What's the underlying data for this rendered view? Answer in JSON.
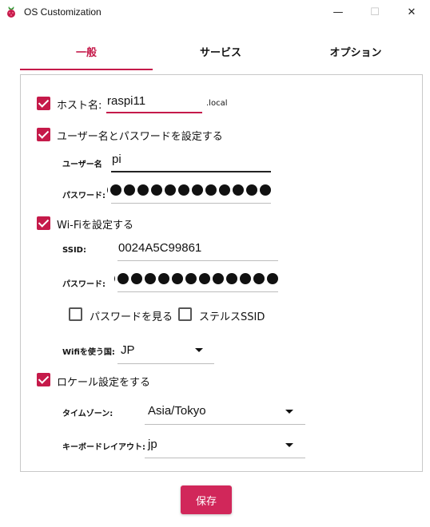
{
  "window": {
    "title": "OS Customization",
    "minimize_glyph": "—",
    "maximize_glyph": "☐",
    "close_glyph": "✕"
  },
  "tabs": [
    {
      "label": "一般",
      "active": true
    },
    {
      "label": "サービス",
      "active": false
    },
    {
      "label": "オプション",
      "active": false
    }
  ],
  "hostname": {
    "checked": true,
    "label": "ホスト名:",
    "value": "raspi11",
    "suffix": ".local"
  },
  "user": {
    "checked": true,
    "label": "ユーザー名とパスワードを設定する",
    "username_label": "ユーザー名",
    "username_value": "pi",
    "password_label": "パスワード:",
    "password_dot_count": 14
  },
  "wifi": {
    "checked": true,
    "label": "Wi-Fiを設定する",
    "ssid_label": "SSID:",
    "ssid_value": "0024A5C99861",
    "password_label": "パスワード:",
    "password_dot_count": 14,
    "show_password_label": "パスワードを見る",
    "show_password_checked": false,
    "hidden_ssid_label": "ステルスSSID",
    "hidden_ssid_checked": false,
    "country_label": "Wifiを使う国:",
    "country_value": "JP"
  },
  "locale": {
    "checked": true,
    "label": "ロケール設定をする",
    "timezone_label": "タイムゾーン:",
    "timezone_value": "Asia/Tokyo",
    "keyboard_label": "キーボードレイアウト:",
    "keyboard_value": "jp"
  },
  "save_label": "保存",
  "colors": {
    "accent": "#c51a4a",
    "button": "#d1275a"
  },
  "icons": {
    "app": "raspberry-icon",
    "dropdown": "caret-down-icon"
  }
}
